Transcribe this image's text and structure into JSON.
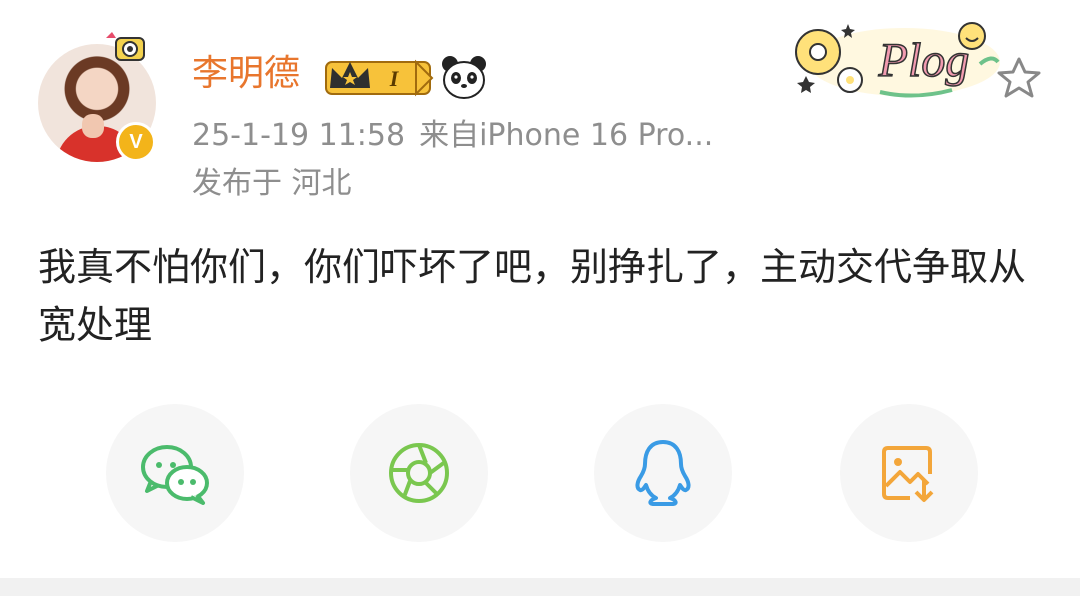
{
  "post": {
    "username": "李明德",
    "level_badge": "I",
    "timestamp": "25-1-19 11:58",
    "source": "来自iPhone 16 Pro...",
    "location": "发布于 河北",
    "content": "我真不怕你们，你们吓坏了吧，别挣扎了，主动交代争取从宽处理",
    "verified_badge": "V",
    "sticker_text": "Plog"
  },
  "share": {
    "items": [
      {
        "icon": "wechat-icon",
        "color": "#4bbb6c"
      },
      {
        "icon": "moments-icon",
        "color": "#7ac74f"
      },
      {
        "icon": "qq-icon",
        "color": "#3a9be5"
      },
      {
        "icon": "save-image-icon",
        "color": "#f3a63a"
      }
    ]
  },
  "colors": {
    "username": "#e8762d",
    "meta": "#8e8e8e",
    "text": "#222222",
    "verified": "#f3b41a"
  }
}
